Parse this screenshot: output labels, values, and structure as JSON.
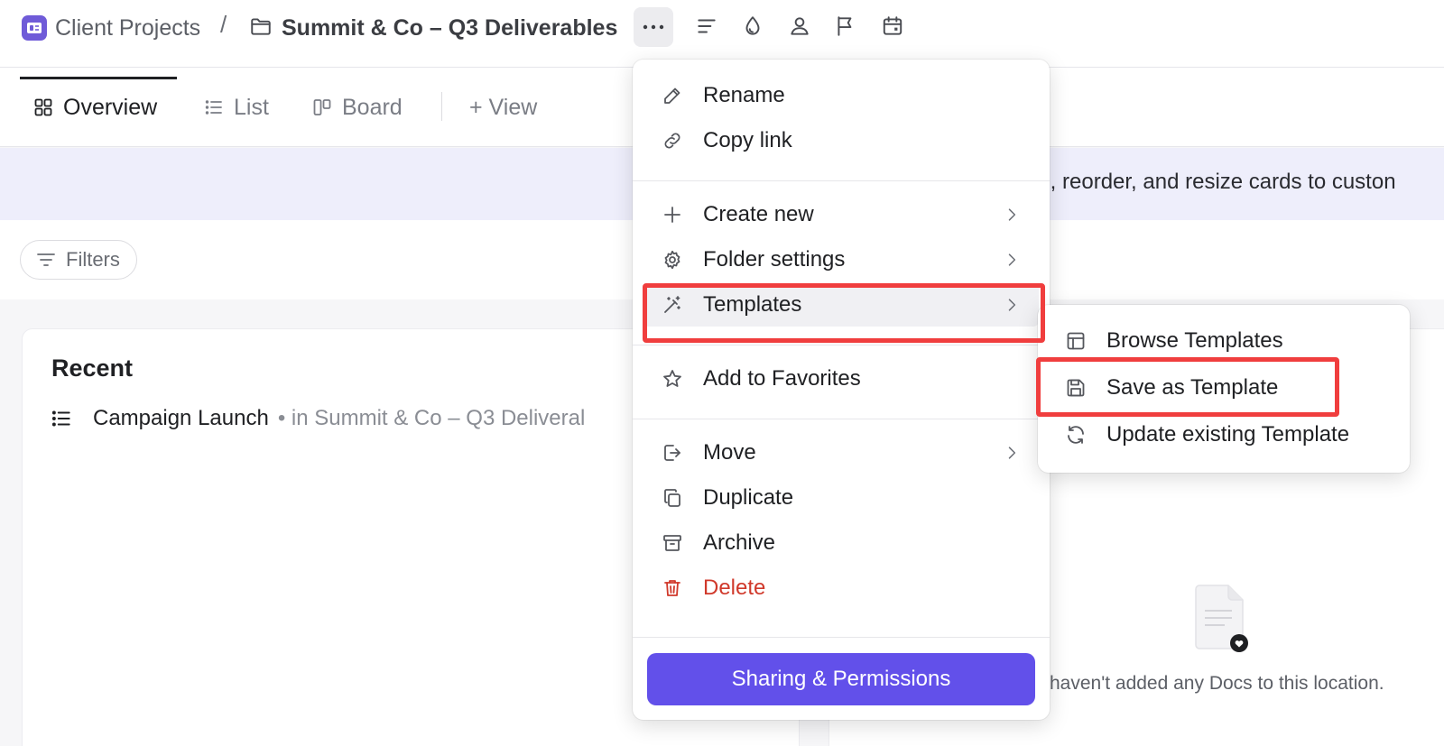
{
  "breadcrumb": {
    "space": "Client Projects",
    "separator": "/",
    "folder": "Summit & Co – Q3 Deliverables"
  },
  "tabs": [
    {
      "label": "Overview",
      "active": true
    },
    {
      "label": "List"
    },
    {
      "label": "Board"
    },
    {
      "label": "+ View"
    }
  ],
  "banner": {
    "text": "ld, reorder, and resize cards to custon"
  },
  "filters": {
    "label": "Filters"
  },
  "recent": {
    "title": "Recent",
    "items": [
      {
        "name": "Campaign Launch",
        "location": "• in Summit & Co – Q3 Deliveral"
      }
    ]
  },
  "docs_card": {
    "empty_text": "haven't added any Docs to this location."
  },
  "menu": {
    "items": {
      "rename": "Rename",
      "copy_link": "Copy link",
      "create_new": "Create new",
      "folder_settings": "Folder settings",
      "templates": "Templates",
      "add_favorites": "Add to Favorites",
      "move": "Move",
      "duplicate": "Duplicate",
      "archive": "Archive",
      "delete": "Delete"
    },
    "share_button": "Sharing & Permissions"
  },
  "submenu": {
    "items": {
      "browse": "Browse Templates",
      "save": "Save as Template",
      "update": "Update existing Template"
    }
  },
  "colors": {
    "accent": "#6250ea",
    "highlight": "#f03e3e",
    "danger": "#d0392b"
  }
}
